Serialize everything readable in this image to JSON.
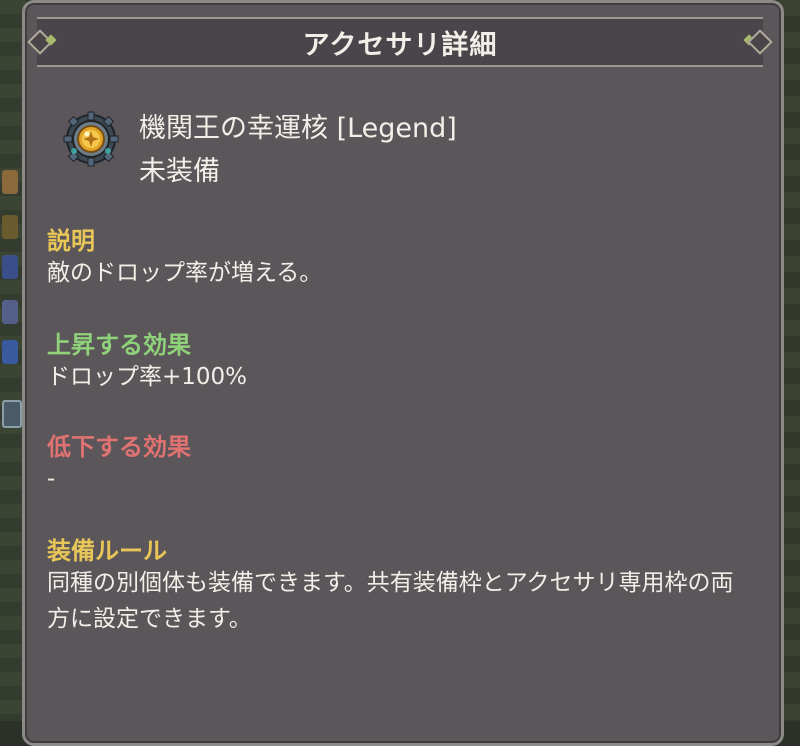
{
  "window": {
    "title": "アクセサリ詳細"
  },
  "item": {
    "icon": "gear-gem-medallion-icon",
    "name": "機関王の幸運核 [Legend]",
    "status": "未装備"
  },
  "sections": {
    "description": {
      "heading": "説明",
      "text": "敵のドロップ率が増える。"
    },
    "buffs": {
      "heading": "上昇する効果",
      "text": "ドロップ率+100%"
    },
    "debuffs": {
      "heading": "低下する効果",
      "text": "-"
    },
    "rules": {
      "heading": "装備ルール",
      "text": "同種の別個体も装備できます。共有装備枠とアクセサリ専用枠の両方に設定できます。"
    }
  },
  "colors": {
    "panel_bg": "#5b5659",
    "heading_yellow": "#e8c658",
    "heading_green": "#8fd27a",
    "heading_red": "#e07272",
    "text": "#f2efe8"
  }
}
